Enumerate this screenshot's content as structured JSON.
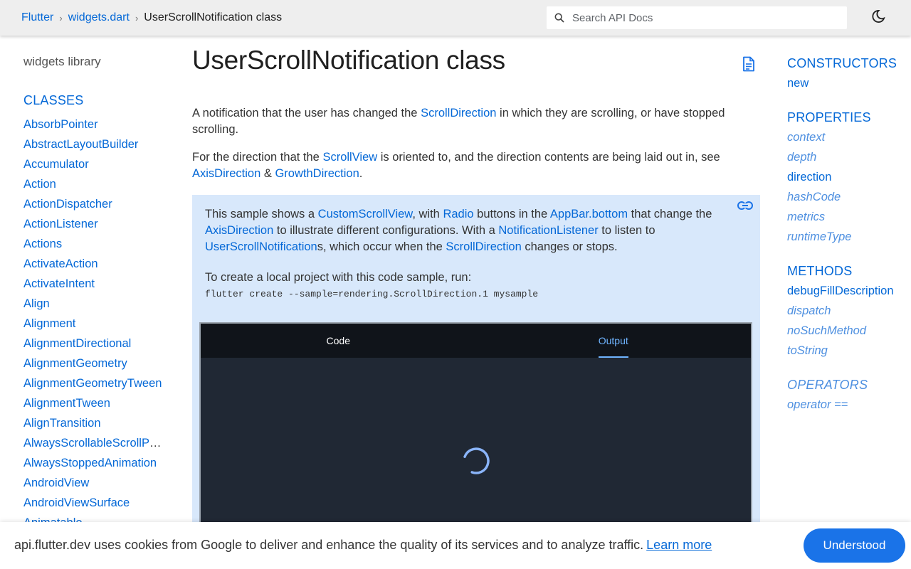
{
  "breadcrumb": {
    "items": [
      "Flutter",
      "widgets.dart"
    ],
    "current": "UserScrollNotification class",
    "separator": "›"
  },
  "search": {
    "placeholder": "Search API Docs",
    "icon": "search-icon"
  },
  "theme_toggle": {
    "icon": "moon-icon"
  },
  "left_nav": {
    "library": "widgets library",
    "classes_header": "CLASSES",
    "classes": [
      "AbsorbPointer",
      "AbstractLayoutBuilder",
      "Accumulator",
      "Action",
      "ActionDispatcher",
      "ActionListener",
      "Actions",
      "ActivateAction",
      "ActivateIntent",
      "Align",
      "Alignment",
      "AlignmentDirectional",
      "AlignmentGeometry",
      "AlignmentGeometryTween",
      "AlignmentTween",
      "AlignTransition",
      "AlwaysScrollableScrollPhysics",
      "AlwaysStoppedAnimation",
      "AndroidView",
      "AndroidViewSurface",
      "Animatable"
    ]
  },
  "main": {
    "title": "UserScrollNotification class",
    "doc_icon": "document-icon",
    "desc1": {
      "pre": "A notification that the user has changed the ",
      "link": "ScrollDirection",
      "post": " in which they are scrolling, or have stopped scrolling."
    },
    "desc2": {
      "pre": "For the direction that the ",
      "link1": "ScrollView",
      "mid": " is oriented to, and the direction contents are being laid out in, see ",
      "link2": "AxisDirection",
      "amp": " & ",
      "link3": "GrowthDirection",
      "end": "."
    },
    "sample": {
      "link_icon": "link-icon",
      "t1": "This sample shows a ",
      "l1": "CustomScrollView",
      "t2": ", with ",
      "l2": "Radio",
      "t3": " buttons in the ",
      "l3": "AppBar.bottom",
      "t4": " that change the ",
      "l4": "AxisDirection",
      "t5": " to illustrate different configurations. With a ",
      "l5": "NotificationListener",
      "t6": " to listen to ",
      "l6": "UserScrollNotification",
      "t7": "s, which occur when the ",
      "l7": "ScrollDirection",
      "t8": " changes or stops.",
      "run_text": "To create a local project with this code sample, run:",
      "command": "flutter create --sample=rendering.ScrollDirection.1 mysample"
    },
    "dartpad": {
      "tabs": [
        "Code",
        "Output"
      ],
      "active_tab": "Output",
      "loading": true
    }
  },
  "right_nav": {
    "constructors": {
      "header": "CONSTRUCTORS",
      "items": [
        "new"
      ]
    },
    "properties": {
      "header": "PROPERTIES",
      "items": [
        "context",
        "depth",
        "direction",
        "hashCode",
        "metrics",
        "runtimeType"
      ]
    },
    "methods": {
      "header": "METHODS",
      "items": [
        "debugFillDescription",
        "dispatch",
        "noSuchMethod",
        "toString"
      ]
    },
    "operators": {
      "header": "OPERATORS",
      "items": [
        "operator =="
      ]
    }
  },
  "cookie_bar": {
    "text": "api.flutter.dev uses cookies from Google to deliver and enhance the quality of its services and to analyze traffic.",
    "learn_more": "Learn more",
    "button": "Understood"
  },
  "colors": {
    "link": "#0468d7",
    "sample_bg": "#d8e8fb",
    "button": "#1a73e8",
    "dartpad_bg": "#202834"
  }
}
